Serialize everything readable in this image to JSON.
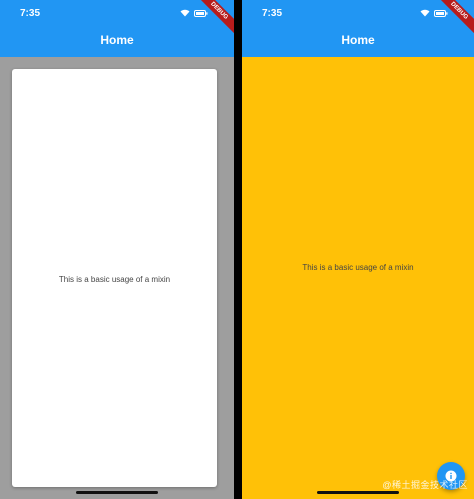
{
  "screens": [
    {
      "status_time": "7:35",
      "appbar_title": "Home",
      "debug_banner": "DEBUG",
      "body_text": "This is a basic usage of a mixin"
    },
    {
      "status_time": "7:35",
      "appbar_title": "Home",
      "debug_banner": "DEBUG",
      "body_text": "This is a basic usage of a mixin"
    }
  ],
  "watermark": "@稀土掘金技术社区",
  "colors": {
    "appbar": "#2196F3",
    "left_background": "#9E9E9E",
    "card": "#FFFFFF",
    "right_background": "#FFC107",
    "fab": "#2196F3",
    "debug_banner": "#B71C1C"
  },
  "icons": {
    "status": [
      "wifi-icon",
      "battery-icon"
    ],
    "fab": "info-icon"
  }
}
